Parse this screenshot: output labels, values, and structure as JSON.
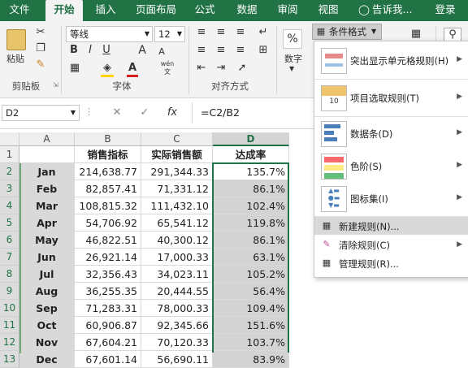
{
  "tabs": [
    "文件",
    "开始",
    "插入",
    "页面布局",
    "公式",
    "数据",
    "审阅",
    "视图"
  ],
  "tell_me": "告诉我...",
  "login": "登录",
  "clipboard": {
    "paste": "粘贴",
    "label": "剪贴板"
  },
  "font": {
    "name": "等线",
    "size": "12",
    "label": "字体",
    "bold": "B",
    "italic": "I",
    "underline": "U",
    "grow": "A",
    "shrink": "A",
    "wen": "wén",
    "color_letter": "A"
  },
  "alignment": {
    "label": "对齐方式"
  },
  "number": {
    "percent": "%",
    "label": "数字"
  },
  "cond_format_button": "条件格式",
  "name_box": "D2",
  "fx": "fx",
  "formula": "=C2/B2",
  "columns": [
    "A",
    "B",
    "C",
    "D"
  ],
  "rows": [
    [
      "",
      "销售指标",
      "实际销售额",
      "达成率"
    ],
    [
      "Jan",
      "214,638.77",
      "291,344.33",
      "135.7%"
    ],
    [
      "Feb",
      "82,857.41",
      "71,331.12",
      "86.1%"
    ],
    [
      "Mar",
      "108,815.32",
      "111,432.10",
      "102.4%"
    ],
    [
      "Apr",
      "54,706.92",
      "65,541.12",
      "119.8%"
    ],
    [
      "May",
      "46,822.51",
      "40,300.12",
      "86.1%"
    ],
    [
      "Jun",
      "26,921.14",
      "17,000.33",
      "63.1%"
    ],
    [
      "Jul",
      "32,356.43",
      "34,023.11",
      "105.2%"
    ],
    [
      "Aug",
      "36,255.35",
      "20,444.55",
      "56.4%"
    ],
    [
      "Sep",
      "71,283.31",
      "78,000.33",
      "109.4%"
    ],
    [
      "Oct",
      "60,906.87",
      "92,345.66",
      "151.6%"
    ],
    [
      "Nov",
      "67,604.21",
      "70,120.33",
      "103.7%"
    ],
    [
      "Dec",
      "67,601.14",
      "56,690.11",
      "83.9%"
    ]
  ],
  "row_numbers": [
    "1",
    "2",
    "3",
    "4",
    "5",
    "6",
    "7",
    "8",
    "9",
    "10",
    "11",
    "12",
    "13"
  ],
  "menu": {
    "highlight": "突出显示单元格规则(H)",
    "topbottom": "项目选取规则(T)",
    "databar": "数据条(D)",
    "colorscale": "色阶(S)",
    "iconset": "图标集(I)",
    "newrule": "新建规则(N)...",
    "clear": "清除规则(C)",
    "manage": "管理规则(R)..."
  },
  "colors": {
    "excel_green": "#217346",
    "selection": "#217346"
  }
}
